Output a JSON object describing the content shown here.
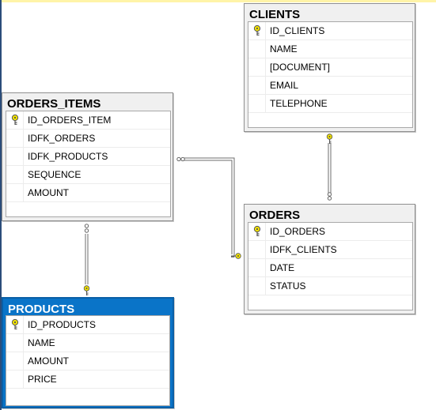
{
  "colors": {
    "selected_header": "#0a74c8",
    "key_icon": "#f2e200",
    "relationship_line": "#6e6e6e"
  },
  "tables": {
    "clients": {
      "title": "CLIENTS",
      "columns": [
        {
          "name": "ID_CLIENTS",
          "primary_key": true,
          "icon": "key-icon"
        },
        {
          "name": "NAME",
          "primary_key": false
        },
        {
          "name": "[DOCUMENT]",
          "primary_key": false
        },
        {
          "name": "EMAIL",
          "primary_key": false
        },
        {
          "name": "TELEPHONE",
          "primary_key": false
        }
      ]
    },
    "orders_items": {
      "title": "ORDERS_ITEMS",
      "columns": [
        {
          "name": "ID_ORDERS_ITEM",
          "primary_key": true,
          "icon": "key-icon"
        },
        {
          "name": "IDFK_ORDERS",
          "primary_key": false
        },
        {
          "name": "IDFK_PRODUCTS",
          "primary_key": false
        },
        {
          "name": "SEQUENCE",
          "primary_key": false
        },
        {
          "name": "AMOUNT",
          "primary_key": false
        }
      ]
    },
    "orders": {
      "title": "ORDERS",
      "columns": [
        {
          "name": "ID_ORDERS",
          "primary_key": true,
          "icon": "key-icon"
        },
        {
          "name": "IDFK_CLIENTS",
          "primary_key": false
        },
        {
          "name": "DATE",
          "primary_key": false
        },
        {
          "name": "STATUS",
          "primary_key": false
        }
      ]
    },
    "products": {
      "title": "PRODUCTS",
      "selected": true,
      "columns": [
        {
          "name": "ID_PRODUCTS",
          "primary_key": true,
          "icon": "key-icon"
        },
        {
          "name": "NAME",
          "primary_key": false
        },
        {
          "name": "AMOUNT",
          "primary_key": false
        },
        {
          "name": "PRICE",
          "primary_key": false
        }
      ]
    }
  },
  "relationships": [
    {
      "from": "ORDERS",
      "to": "CLIENTS",
      "one_end": "CLIENTS",
      "many_end": "ORDERS"
    },
    {
      "from": "ORDERS_ITEMS",
      "to": "ORDERS",
      "one_end": "ORDERS",
      "many_end": "ORDERS_ITEMS"
    },
    {
      "from": "ORDERS_ITEMS",
      "to": "PRODUCTS",
      "one_end": "PRODUCTS",
      "many_end": "ORDERS_ITEMS"
    }
  ]
}
